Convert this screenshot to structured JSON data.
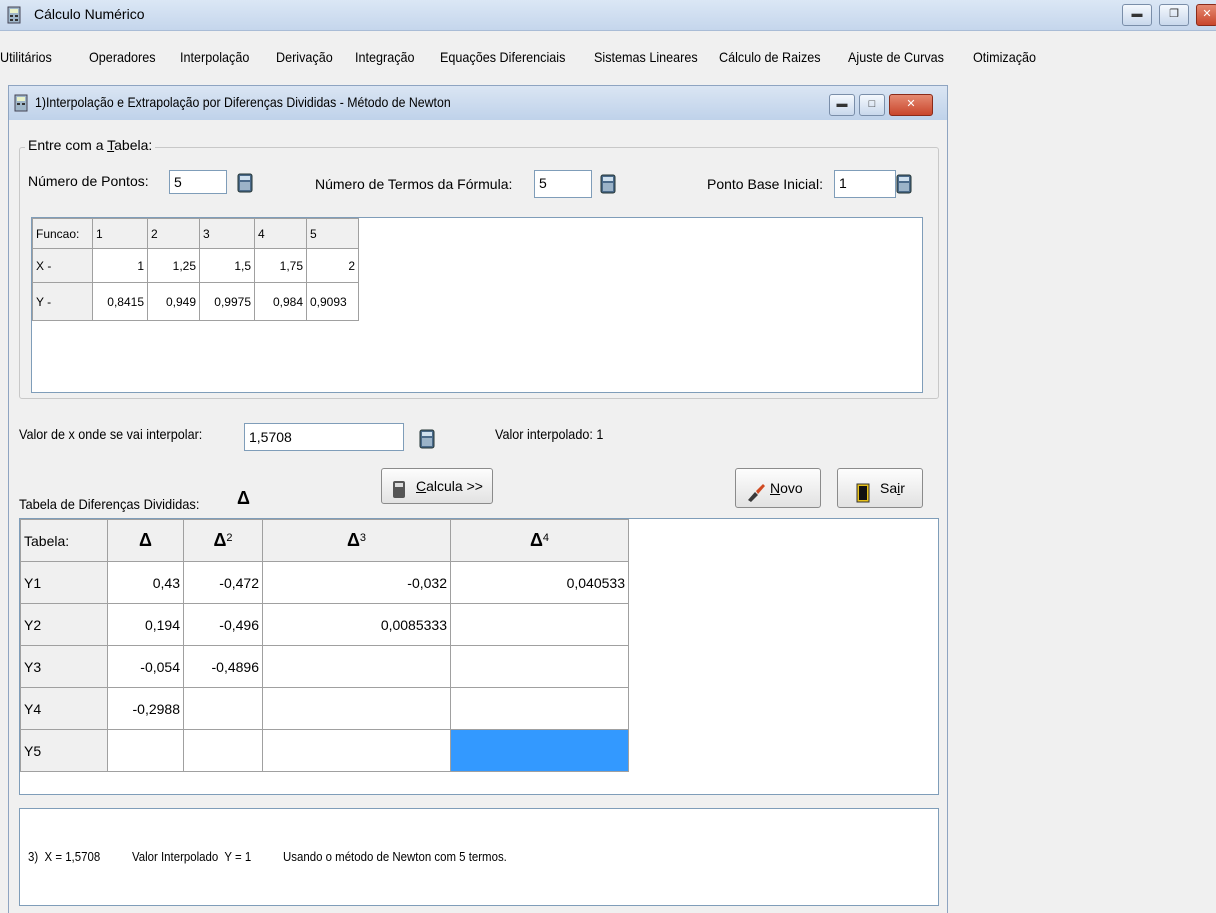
{
  "app": {
    "title": "Cálculo Numérico"
  },
  "menu": [
    "Utilitários",
    "Operadores",
    "Interpolação",
    "Derivação",
    "Integração",
    "Equações Diferenciais",
    "Sistemas Lineares",
    "Cálculo de Raizes",
    "Ajuste de Curvas",
    "Otimização"
  ],
  "window": {
    "title": "1)Interpolação e Extrapolação por Diferenças Divididas - Método de Newton"
  },
  "input_group": {
    "legend_prefix": "Entre com a ",
    "legend_key": "T",
    "legend_rest": "abela:",
    "num_pontos_label": "Número de Pontos:",
    "num_pontos_value": "5",
    "num_termos_label": "Número de Termos da Fórmula:",
    "num_termos_value": "5",
    "ponto_base_label": "Ponto Base Inicial:",
    "ponto_base_value": "1"
  },
  "data_table": {
    "header": [
      "Funcao:",
      "1",
      "2",
      "3",
      "4",
      "5"
    ],
    "rows": [
      [
        "X -",
        "1",
        "1,25",
        "1,5",
        "1,75",
        "2"
      ],
      [
        "Y -",
        "0,8415",
        "0,949",
        "0,9975",
        "0,984",
        "0,9093"
      ]
    ]
  },
  "interp": {
    "x_label": "Valor de x onde se vai interpolar:",
    "x_value": "1,5708",
    "result_label": "Valor interpolado: 1"
  },
  "buttons": {
    "calcula_key": "C",
    "calcula_rest": "alcula >>",
    "novo_key": "N",
    "novo_rest": "ovo",
    "sair_pre": "Sa",
    "sair_key": "i",
    "sair_post": "r"
  },
  "diff_table": {
    "caption": "Tabela de Diferenças Divididas:",
    "header_first": "Tabela:",
    "powers": [
      "",
      "2",
      "3",
      "4"
    ],
    "rows": [
      [
        "Y1",
        "0,43",
        "-0,472",
        "-0,032",
        "0,040533"
      ],
      [
        "Y2",
        "0,194",
        "-0,496",
        "0,0085333",
        ""
      ],
      [
        "Y3",
        "-0,054",
        "-0,4896",
        "",
        ""
      ],
      [
        "Y4",
        "-0,2988",
        "",
        "",
        ""
      ],
      [
        "Y5",
        "",
        "",
        "",
        ""
      ]
    ],
    "highlight_color": "#3399ff"
  },
  "output": {
    "line": "3)  X = 1,5708          Valor Interpolado  Y = 1          Usando o método de Newton com 5 termos."
  },
  "colors": {
    "close_button": "#c9462c"
  }
}
